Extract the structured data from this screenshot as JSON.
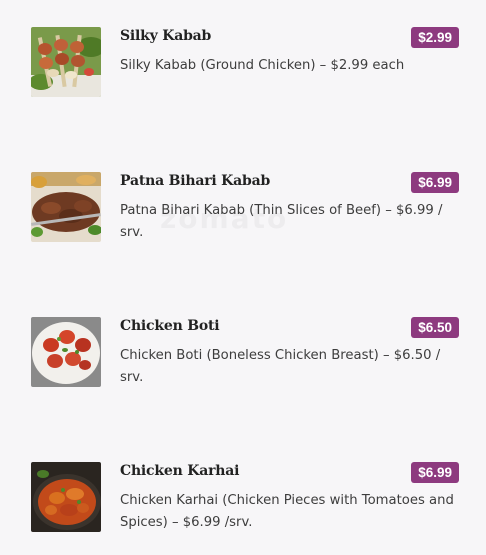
{
  "watermark": "zomato",
  "menu": {
    "items": [
      {
        "name": "Silky Kabab",
        "price": "$2.99",
        "description": "Silky Kabab (Ground Chicken) – $2.99 each"
      },
      {
        "name": "Patna Bihari Kabab",
        "price": "$6.99",
        "description": "Patna Bihari Kabab (Thin Slices of Beef) – $6.99 / srv."
      },
      {
        "name": "Chicken Boti",
        "price": "$6.50",
        "description": "Chicken Boti (Boneless Chicken Breast) – $6.50 / srv."
      },
      {
        "name": "Chicken Karhai",
        "price": "$6.99",
        "description": "Chicken Karhai (Chicken Pieces with Tomatoes and Spices) – $6.99 /srv."
      }
    ]
  },
  "colors": {
    "price_badge": "#8d3a7f",
    "background": "#f7f6f8"
  }
}
